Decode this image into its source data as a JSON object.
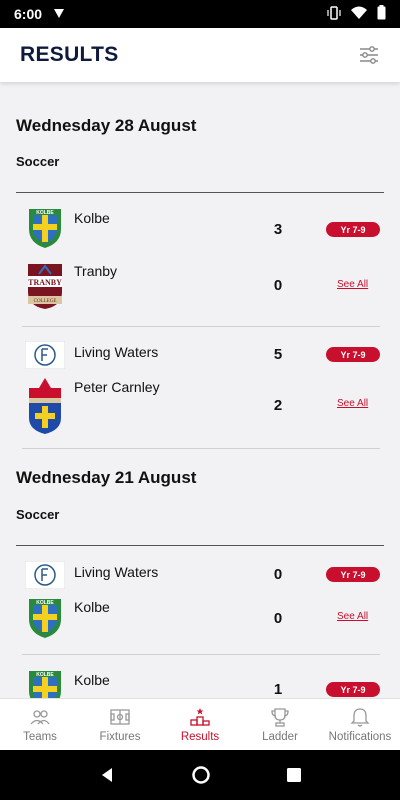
{
  "status": {
    "time": "6:00"
  },
  "header": {
    "title": "RESULTS"
  },
  "sections": [
    {
      "date": "Wednesday 28 August",
      "sport": "Soccer",
      "matches": [
        {
          "home": {
            "name": "Kolbe",
            "score": "3"
          },
          "away": {
            "name": "Tranby",
            "score": "0"
          },
          "year": "Yr 7-9",
          "see_all": "See All"
        },
        {
          "home": {
            "name": "Living Waters",
            "score": "5"
          },
          "away": {
            "name": "Peter Carnley",
            "score": "2"
          },
          "year": "Yr 7-9",
          "see_all": "See All"
        }
      ]
    },
    {
      "date": "Wednesday 21 August",
      "sport": "Soccer",
      "matches": [
        {
          "home": {
            "name": "Living Waters",
            "score": "0"
          },
          "away": {
            "name": "Kolbe",
            "score": "0"
          },
          "year": "Yr 7-9",
          "see_all": "See All"
        },
        {
          "home": {
            "name": "Kolbe",
            "score": "1"
          },
          "year": "Yr 7-9"
        }
      ]
    }
  ],
  "logos": {
    "kolbe": "KOLBE",
    "tranby": "TRANBY",
    "tranby_sub": "COLLEGE"
  },
  "nav": {
    "teams": "Teams",
    "fixtures": "Fixtures",
    "results": "Results",
    "ladder": "Ladder",
    "notifications": "Notifications"
  },
  "colors": {
    "accent": "#c8102e",
    "title": "#0f1b3d"
  }
}
